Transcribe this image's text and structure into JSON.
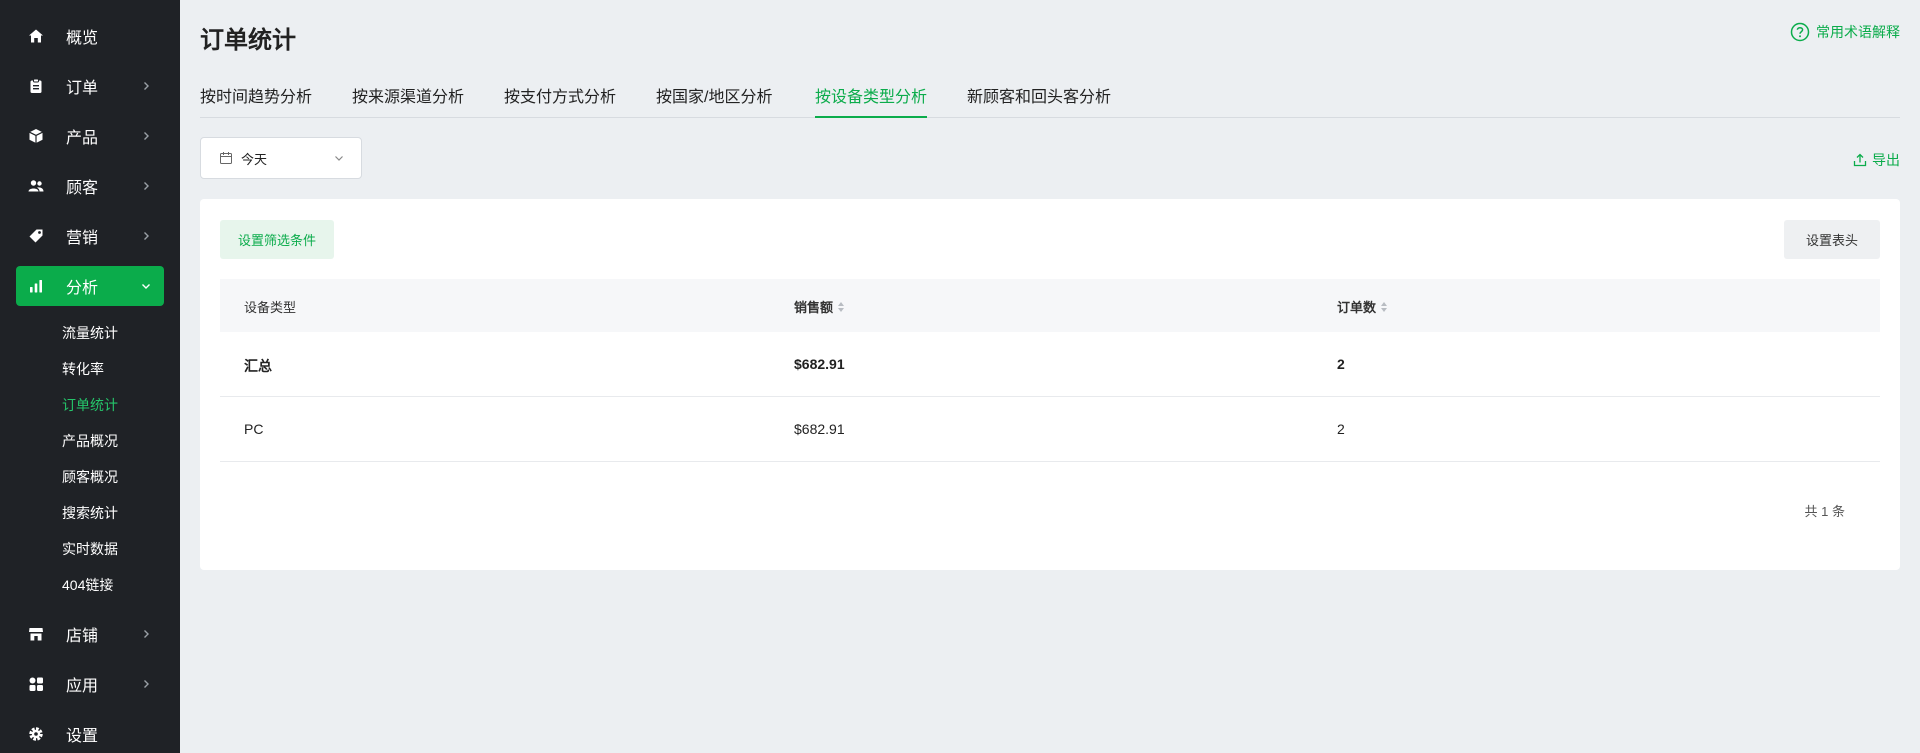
{
  "sidebar": {
    "items": [
      {
        "label": "概览",
        "icon": "home-icon",
        "has_chevron": false
      },
      {
        "label": "订单",
        "icon": "clipboard-icon",
        "has_chevron": true
      },
      {
        "label": "产品",
        "icon": "box-icon",
        "has_chevron": true
      },
      {
        "label": "顾客",
        "icon": "users-icon",
        "has_chevron": true
      },
      {
        "label": "营销",
        "icon": "tag-icon",
        "has_chevron": true
      },
      {
        "label": "分析",
        "icon": "bar-chart-icon",
        "has_chevron": true,
        "active": true
      },
      {
        "label": "店铺",
        "icon": "store-icon",
        "has_chevron": true
      },
      {
        "label": "应用",
        "icon": "apps-icon",
        "has_chevron": true
      },
      {
        "label": "设置",
        "icon": "gear-icon",
        "has_chevron": false
      }
    ],
    "sub_items": [
      "流量统计",
      "转化率",
      "订单统计",
      "产品概况",
      "顾客概况",
      "搜索统计",
      "实时数据",
      "404链接"
    ],
    "active_sub": "订单统计"
  },
  "header": {
    "title": "订单统计",
    "help_label": "常用术语解释"
  },
  "tabs": [
    "按时间趋势分析",
    "按来源渠道分析",
    "按支付方式分析",
    "按国家/地区分析",
    "按设备类型分析",
    "新顾客和回头客分析"
  ],
  "active_tab": "按设备类型分析",
  "date_filter": {
    "value": "今天"
  },
  "export_label": "导出",
  "card": {
    "filter_button": "设置筛选条件",
    "header_button": "设置表头"
  },
  "table": {
    "columns": [
      "设备类型",
      "销售额",
      "订单数"
    ],
    "total_row": [
      "汇总",
      "$682.91",
      "2"
    ],
    "rows": [
      [
        "PC",
        "$682.91",
        "2"
      ]
    ]
  },
  "pagination": {
    "total_text": "共 1 条"
  },
  "colors": {
    "accent": "#0bac4b",
    "sidebar_bg": "#1f2226",
    "page_bg": "#eceff2"
  }
}
